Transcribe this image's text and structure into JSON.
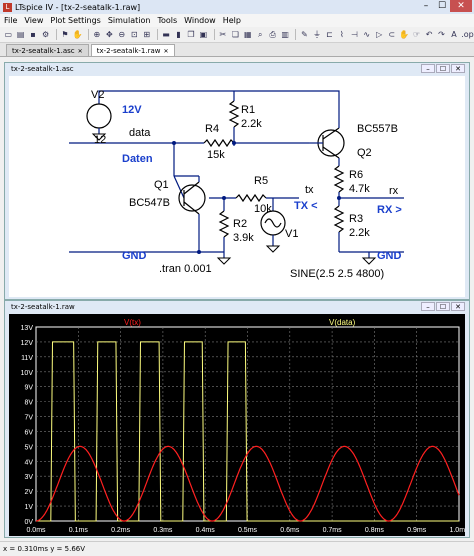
{
  "window": {
    "title": "LTspice IV - [tx-2-seatalk-1.raw]",
    "minimize": "–",
    "maximize": "☐",
    "close": "✕"
  },
  "menu": [
    "File",
    "View",
    "Plot Settings",
    "Simulation",
    "Tools",
    "Window",
    "Help"
  ],
  "tabs": [
    {
      "label": "tx-2-seatalk-1.asc"
    },
    {
      "label": "tx-2-seatalk-1.raw"
    }
  ],
  "schematic": {
    "title": "tx-2-seatalk-1.asc",
    "labels": {
      "v2": "V2",
      "v2_val": "12",
      "v12": "12V",
      "r1": "R1",
      "r1_val": "2.2k",
      "data": "data",
      "r4": "R4",
      "r4_val": "15k",
      "daten": "Daten",
      "q2_type": "BC557B",
      "q2": "Q2",
      "r6": "R6",
      "r6_val": "4.7k",
      "rx": "rx",
      "rx_arrow": "RX >",
      "q1": "Q1",
      "q1_type": "BC547B",
      "r5": "R5",
      "r5_val": "10k",
      "tx": "tx",
      "tx_arrow": "TX <",
      "r2": "R2",
      "r2_val": "3.9k",
      "r3": "R3",
      "r3_val": "2.2k",
      "v1": "V1",
      "v1_val": "SINE(2.5 2.5 4800)",
      "gnd1": "GND",
      "gnd2": "GND",
      "tran": ".tran 0.001"
    }
  },
  "plot": {
    "title": "tx-2-seatalk-1.raw",
    "trace_tx": "V(tx)",
    "trace_data": "V(data)",
    "colors": {
      "tx": "#ff2020",
      "data": "#ffff80",
      "grid": "#7a7a7a",
      "axis": "#ffffff",
      "background": "#000000"
    }
  },
  "chart_data": {
    "type": "line",
    "xlabel": "",
    "ylabel": "",
    "xlim": [
      0,
      1.0
    ],
    "ylim": [
      0,
      13
    ],
    "x_ticks": [
      "0.0ms",
      "0.1ms",
      "0.2ms",
      "0.3ms",
      "0.4ms",
      "0.5ms",
      "0.6ms",
      "0.7ms",
      "0.8ms",
      "0.9ms",
      "1.0ms"
    ],
    "y_ticks": [
      "0V",
      "1V",
      "2V",
      "3V",
      "4V",
      "5V",
      "6V",
      "7V",
      "8V",
      "9V",
      "10V",
      "11V",
      "12V",
      "13V"
    ],
    "series": [
      {
        "name": "V(tx)",
        "kind": "sine",
        "offset": 2.5,
        "amplitude": 2.5,
        "frequency_hz": 4800,
        "phase_deg": 90,
        "unit": "V"
      },
      {
        "name": "V(data)",
        "kind": "square",
        "low": 0,
        "high": 12,
        "rise_ms": [
          0.035,
          0.142,
          0.243,
          0.347,
          0.45
        ],
        "fall_ms": [
          0.093,
          0.193,
          0.295,
          0.397,
          0.499
        ],
        "note_unit": "V"
      }
    ]
  },
  "status": {
    "text": "x = 0.310ms   y = 5.66V"
  }
}
